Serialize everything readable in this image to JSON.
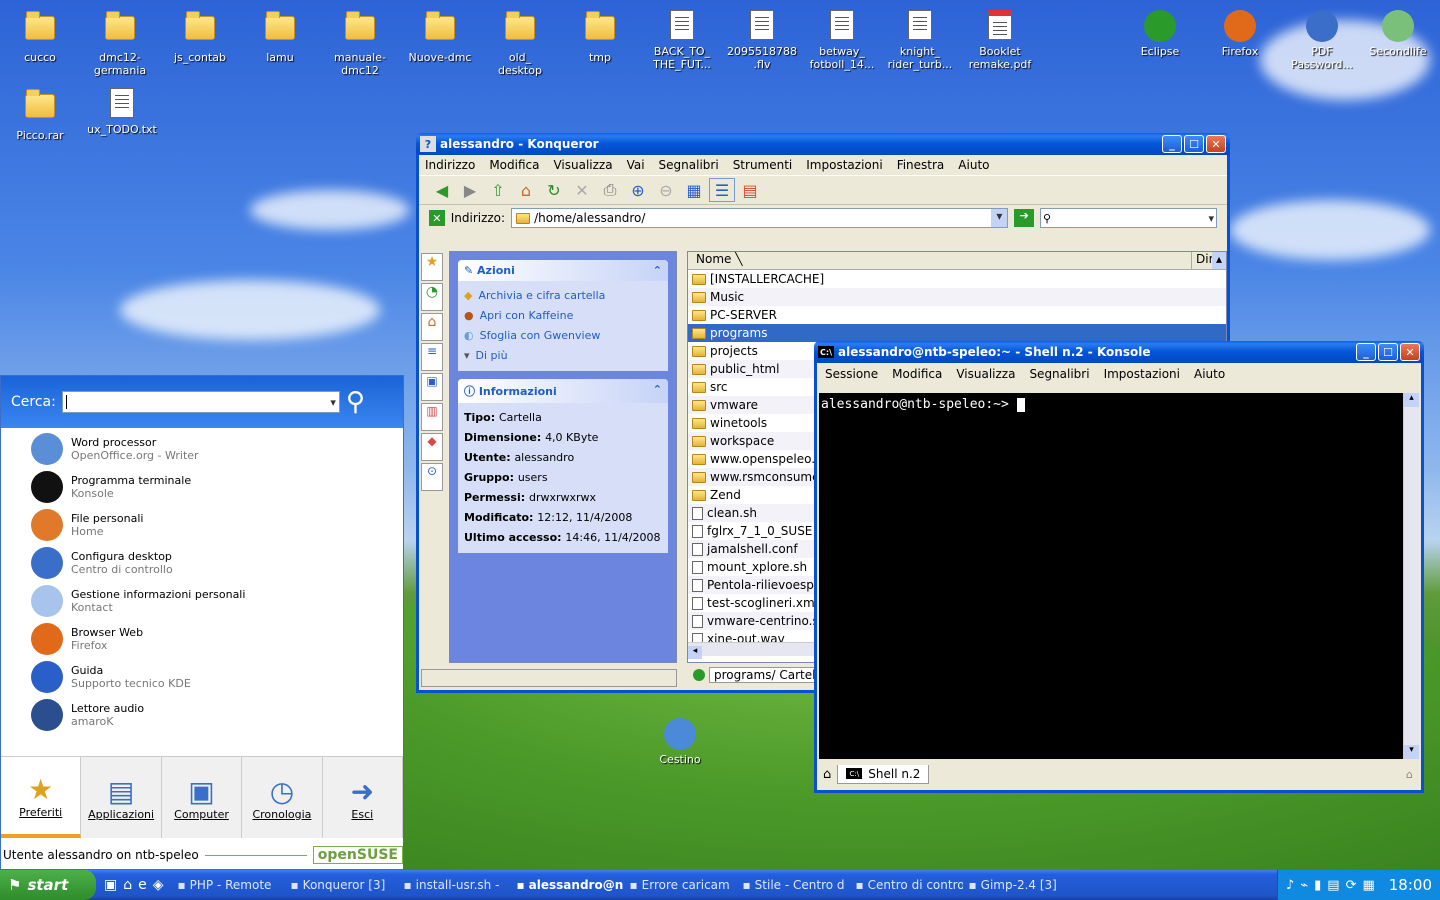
{
  "desktop_icons": [
    {
      "label": "cucco"
    },
    {
      "label": "dmc12-\ngermania"
    },
    {
      "label": "js_contab"
    },
    {
      "label": "lamu"
    },
    {
      "label": "manuale-\ndmc12"
    },
    {
      "label": "Nuove-dmc"
    },
    {
      "label": "old_\ndesktop"
    },
    {
      "label": "tmp"
    },
    {
      "label": "BACK_TO_\nTHE_FUT..."
    },
    {
      "label": "2095518788\n.flv"
    },
    {
      "label": "betway_\nfotboll_14..."
    },
    {
      "label": "knight_\nrider_turb..."
    },
    {
      "label": "Booklet\nremake.pdf"
    },
    {
      "label": "Eclipse"
    },
    {
      "label": "Firefox"
    },
    {
      "label": "PDF\nPassword..."
    },
    {
      "label": "Secondlife"
    },
    {
      "label": "Picco.rar"
    },
    {
      "label": "ux_TODO.txt"
    },
    {
      "label": "Cestino"
    }
  ],
  "konqueror": {
    "title": "alessandro - Konqueror",
    "menu": [
      "Indirizzo",
      "Modifica",
      "Visualizza",
      "Vai",
      "Segnalibri",
      "Strumenti",
      "Impostazioni",
      "Finestra",
      "Aiuto"
    ],
    "address_label": "Indirizzo:",
    "address_value": "/home/alessandro/",
    "actions_title": "Azioni",
    "actions": [
      "Archivia e cifra cartella",
      "Apri con Kaffeine",
      "Sfoglia con Gwenview",
      "Di più"
    ],
    "info_title": "Informazioni",
    "info": [
      {
        "k": "Tipo:",
        "v": "Cartella"
      },
      {
        "k": "Dimensione:",
        "v": "4,0 KByte"
      },
      {
        "k": "Utente:",
        "v": "alessandro"
      },
      {
        "k": "Gruppo:",
        "v": "users"
      },
      {
        "k": "Permessi:",
        "v": "drwxrwxrwx"
      },
      {
        "k": "Modificato:",
        "v": "12:12, 11/4/2008"
      },
      {
        "k": "Ultimo accesso:",
        "v": "14:46, 11/4/2008"
      }
    ],
    "col_name": "Nome",
    "col_dir": "Dir",
    "files": [
      {
        "name": "[INSTALLERCACHE]",
        "kind": "folder"
      },
      {
        "name": "Music",
        "kind": "folder"
      },
      {
        "name": "PC-SERVER",
        "kind": "folder"
      },
      {
        "name": "programs",
        "kind": "folder",
        "selected": true
      },
      {
        "name": "projects",
        "kind": "folder"
      },
      {
        "name": "public_html",
        "kind": "folder"
      },
      {
        "name": "src",
        "kind": "folder"
      },
      {
        "name": "vmware",
        "kind": "folder"
      },
      {
        "name": "winetools",
        "kind": "folder"
      },
      {
        "name": "workspace",
        "kind": "folder"
      },
      {
        "name": "www.openspeleo.o",
        "kind": "folder"
      },
      {
        "name": "www.rsmconsumer",
        "kind": "folder"
      },
      {
        "name": "Zend",
        "kind": "folder"
      },
      {
        "name": "clean.sh",
        "kind": "file"
      },
      {
        "name": "fglrx_7_1_0_SUSE",
        "kind": "file"
      },
      {
        "name": "jamalshell.conf",
        "kind": "file"
      },
      {
        "name": "mount_xplore.sh",
        "kind": "file"
      },
      {
        "name": "Pentola-rilievoesplo",
        "kind": "file"
      },
      {
        "name": "test-scoglineri.xml",
        "kind": "file"
      },
      {
        "name": "vmware-centrino.sh",
        "kind": "file"
      },
      {
        "name": "xine-out.wav",
        "kind": "file"
      }
    ],
    "status": "programs/  Cartella"
  },
  "konsole": {
    "title": "alessandro@ntb-speleo:~ - Shell n.2 - Konsole",
    "menu": [
      "Sessione",
      "Modifica",
      "Visualizza",
      "Segnalibri",
      "Impostazioni",
      "Aiuto"
    ],
    "prompt": "alessandro@ntb-speleo:~> ",
    "tab": "Shell n.2"
  },
  "start_menu": {
    "search_label": "Cerca:",
    "items": [
      {
        "title": "Word processor",
        "sub": "OpenOffice.org - Writer",
        "color": "#5a8ed6"
      },
      {
        "title": "Programma terminale",
        "sub": "Konsole",
        "color": "#111111"
      },
      {
        "title": "File personali",
        "sub": "Home",
        "color": "#e07a2a"
      },
      {
        "title": "Configura desktop",
        "sub": "Centro di controllo",
        "color": "#3a6ec8"
      },
      {
        "title": "Gestione informazioni personali",
        "sub": "Kontact",
        "color": "#a8c4ec"
      },
      {
        "title": "Browser Web",
        "sub": "Firefox",
        "color": "#e06a1a"
      },
      {
        "title": "Guida",
        "sub": "Supporto tecnico KDE",
        "color": "#2a5ec8"
      },
      {
        "title": "Lettore audio",
        "sub": "amaroK",
        "color": "#2a4e8e"
      }
    ],
    "tabs": [
      "Preferiti",
      "Applicazioni",
      "Computer",
      "Cronologia",
      "Esci"
    ],
    "footer_user": "Utente alessandro on ntb-speleo",
    "brand": "openSUSE"
  },
  "taskbar": {
    "start": "start",
    "tasks": [
      "PHP - Remote",
      "Konqueror [3]",
      "install-usr.sh -",
      "alessandro@n",
      "Errore caricam",
      "Stile - Centro d",
      "Centro di contro",
      "Gimp-2.4 [3]"
    ],
    "clock": "18:00"
  }
}
